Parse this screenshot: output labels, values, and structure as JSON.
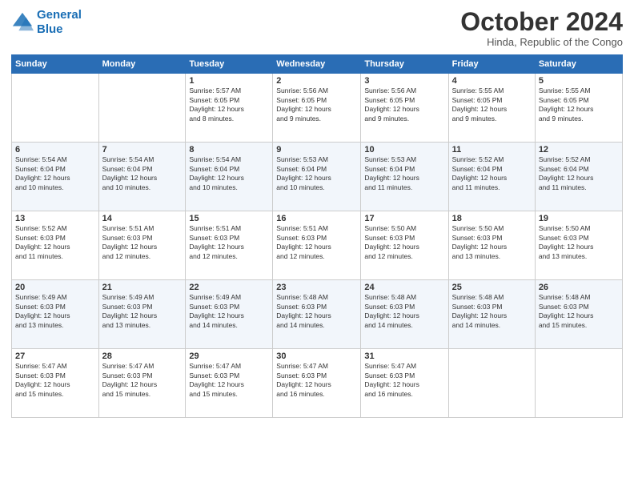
{
  "header": {
    "logo_line1": "General",
    "logo_line2": "Blue",
    "month": "October 2024",
    "location": "Hinda, Republic of the Congo"
  },
  "weekdays": [
    "Sunday",
    "Monday",
    "Tuesday",
    "Wednesday",
    "Thursday",
    "Friday",
    "Saturday"
  ],
  "weeks": [
    [
      {
        "day": "",
        "info": ""
      },
      {
        "day": "",
        "info": ""
      },
      {
        "day": "1",
        "info": "Sunrise: 5:57 AM\nSunset: 6:05 PM\nDaylight: 12 hours\nand 8 minutes."
      },
      {
        "day": "2",
        "info": "Sunrise: 5:56 AM\nSunset: 6:05 PM\nDaylight: 12 hours\nand 9 minutes."
      },
      {
        "day": "3",
        "info": "Sunrise: 5:56 AM\nSunset: 6:05 PM\nDaylight: 12 hours\nand 9 minutes."
      },
      {
        "day": "4",
        "info": "Sunrise: 5:55 AM\nSunset: 6:05 PM\nDaylight: 12 hours\nand 9 minutes."
      },
      {
        "day": "5",
        "info": "Sunrise: 5:55 AM\nSunset: 6:05 PM\nDaylight: 12 hours\nand 9 minutes."
      }
    ],
    [
      {
        "day": "6",
        "info": "Sunrise: 5:54 AM\nSunset: 6:04 PM\nDaylight: 12 hours\nand 10 minutes."
      },
      {
        "day": "7",
        "info": "Sunrise: 5:54 AM\nSunset: 6:04 PM\nDaylight: 12 hours\nand 10 minutes."
      },
      {
        "day": "8",
        "info": "Sunrise: 5:54 AM\nSunset: 6:04 PM\nDaylight: 12 hours\nand 10 minutes."
      },
      {
        "day": "9",
        "info": "Sunrise: 5:53 AM\nSunset: 6:04 PM\nDaylight: 12 hours\nand 10 minutes."
      },
      {
        "day": "10",
        "info": "Sunrise: 5:53 AM\nSunset: 6:04 PM\nDaylight: 12 hours\nand 11 minutes."
      },
      {
        "day": "11",
        "info": "Sunrise: 5:52 AM\nSunset: 6:04 PM\nDaylight: 12 hours\nand 11 minutes."
      },
      {
        "day": "12",
        "info": "Sunrise: 5:52 AM\nSunset: 6:04 PM\nDaylight: 12 hours\nand 11 minutes."
      }
    ],
    [
      {
        "day": "13",
        "info": "Sunrise: 5:52 AM\nSunset: 6:03 PM\nDaylight: 12 hours\nand 11 minutes."
      },
      {
        "day": "14",
        "info": "Sunrise: 5:51 AM\nSunset: 6:03 PM\nDaylight: 12 hours\nand 12 minutes."
      },
      {
        "day": "15",
        "info": "Sunrise: 5:51 AM\nSunset: 6:03 PM\nDaylight: 12 hours\nand 12 minutes."
      },
      {
        "day": "16",
        "info": "Sunrise: 5:51 AM\nSunset: 6:03 PM\nDaylight: 12 hours\nand 12 minutes."
      },
      {
        "day": "17",
        "info": "Sunrise: 5:50 AM\nSunset: 6:03 PM\nDaylight: 12 hours\nand 12 minutes."
      },
      {
        "day": "18",
        "info": "Sunrise: 5:50 AM\nSunset: 6:03 PM\nDaylight: 12 hours\nand 13 minutes."
      },
      {
        "day": "19",
        "info": "Sunrise: 5:50 AM\nSunset: 6:03 PM\nDaylight: 12 hours\nand 13 minutes."
      }
    ],
    [
      {
        "day": "20",
        "info": "Sunrise: 5:49 AM\nSunset: 6:03 PM\nDaylight: 12 hours\nand 13 minutes."
      },
      {
        "day": "21",
        "info": "Sunrise: 5:49 AM\nSunset: 6:03 PM\nDaylight: 12 hours\nand 13 minutes."
      },
      {
        "day": "22",
        "info": "Sunrise: 5:49 AM\nSunset: 6:03 PM\nDaylight: 12 hours\nand 14 minutes."
      },
      {
        "day": "23",
        "info": "Sunrise: 5:48 AM\nSunset: 6:03 PM\nDaylight: 12 hours\nand 14 minutes."
      },
      {
        "day": "24",
        "info": "Sunrise: 5:48 AM\nSunset: 6:03 PM\nDaylight: 12 hours\nand 14 minutes."
      },
      {
        "day": "25",
        "info": "Sunrise: 5:48 AM\nSunset: 6:03 PM\nDaylight: 12 hours\nand 14 minutes."
      },
      {
        "day": "26",
        "info": "Sunrise: 5:48 AM\nSunset: 6:03 PM\nDaylight: 12 hours\nand 15 minutes."
      }
    ],
    [
      {
        "day": "27",
        "info": "Sunrise: 5:47 AM\nSunset: 6:03 PM\nDaylight: 12 hours\nand 15 minutes."
      },
      {
        "day": "28",
        "info": "Sunrise: 5:47 AM\nSunset: 6:03 PM\nDaylight: 12 hours\nand 15 minutes."
      },
      {
        "day": "29",
        "info": "Sunrise: 5:47 AM\nSunset: 6:03 PM\nDaylight: 12 hours\nand 15 minutes."
      },
      {
        "day": "30",
        "info": "Sunrise: 5:47 AM\nSunset: 6:03 PM\nDaylight: 12 hours\nand 16 minutes."
      },
      {
        "day": "31",
        "info": "Sunrise: 5:47 AM\nSunset: 6:03 PM\nDaylight: 12 hours\nand 16 minutes."
      },
      {
        "day": "",
        "info": ""
      },
      {
        "day": "",
        "info": ""
      }
    ]
  ]
}
